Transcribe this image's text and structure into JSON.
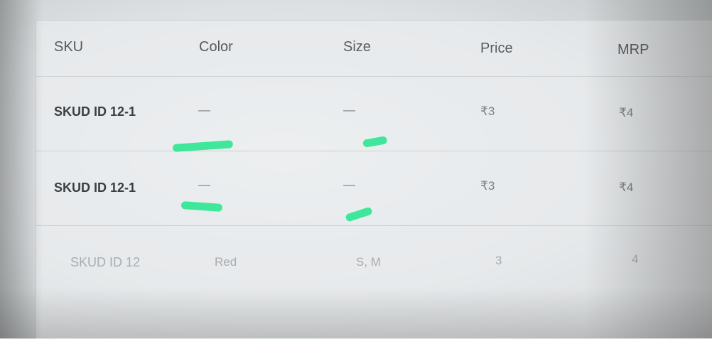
{
  "table": {
    "headers": {
      "sku": "SKU",
      "color": "Color",
      "size": "Size",
      "price": "Price",
      "mrp": "MRP"
    },
    "rows": [
      {
        "sku": "SKUD ID 12-1",
        "color": "—",
        "size": "—",
        "price": "₹3",
        "mrp": "₹4"
      },
      {
        "sku": "SKUD ID 12-1",
        "color": "—",
        "size": "—",
        "price": "₹3",
        "mrp": "₹4"
      },
      {
        "sku": "SKUD ID 12",
        "color": "Red",
        "size": "S, M",
        "price": "3",
        "mrp": "4"
      }
    ]
  },
  "colors": {
    "highlight_mark": "#3fe79a"
  }
}
